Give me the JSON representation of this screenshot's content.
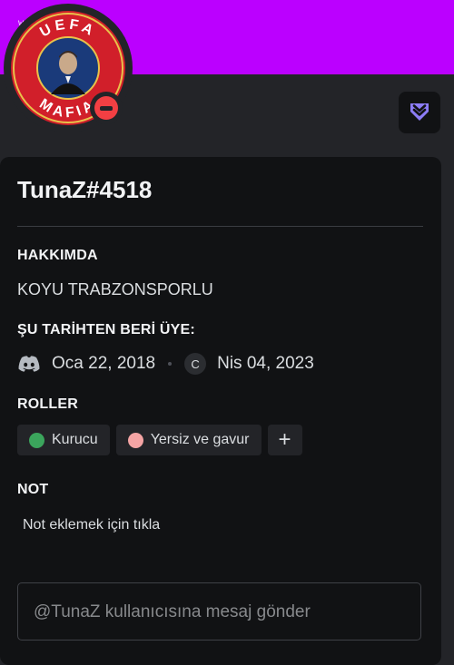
{
  "watermark": "watermark",
  "avatar": {
    "logo_top_text": "UEFA",
    "logo_bottom_text": "MAFIA",
    "status": "do-not-disturb",
    "status_color": "#f23f43",
    "ring_color": "#d11f2a"
  },
  "banner_color": "#bb00ff",
  "badge_icon": "nitro-chevron-icon",
  "profile": {
    "username": "TunaZ#4518",
    "about_title": "HAKKIMDA",
    "about_text": "KOYU TRABZONSPORLU",
    "member_since_title": "ŞU TARİHTEN BERİ ÜYE:",
    "discord_date": "Oca 22, 2018",
    "server_initial": "C",
    "server_date": "Nis 04, 2023",
    "roles_title": "ROLLER",
    "roles": [
      {
        "name": "Kurucu",
        "color": "#3ba55c"
      },
      {
        "name": "Yersiz ve gavur",
        "color": "#f4a4a4"
      }
    ],
    "add_role_label": "+",
    "note_title": "NOT",
    "note_placeholder": "Not eklemek için tıkla"
  },
  "message": {
    "placeholder": "@TunaZ kullanıcısına mesaj gönder"
  }
}
